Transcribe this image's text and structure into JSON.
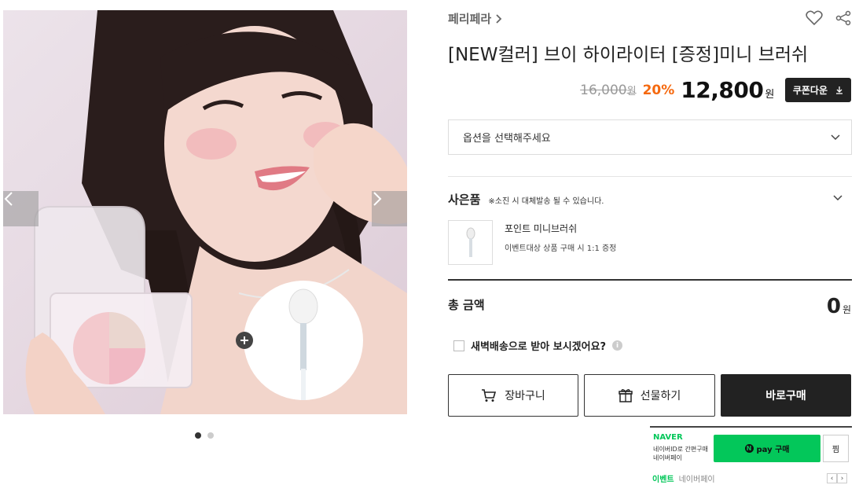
{
  "gallery": {
    "prev_icon": "chevron-left-icon",
    "next_icon": "chevron-right-icon",
    "dot_count": 2,
    "active_dot": 0
  },
  "product": {
    "brand": "페리페라",
    "title": "[NEW컬러] 브이 하이라이터 [증정]미니 브러쉬",
    "original_price": "16,000",
    "original_unit": "원",
    "discount_rate": "20%",
    "final_price": "12,800",
    "final_unit": "원",
    "coupon_label": "쿠폰다운"
  },
  "option": {
    "placeholder": "옵션을 선택해주세요"
  },
  "gift": {
    "heading": "사은품",
    "notice": "※소진 시 대체발송 될 수 있습니다.",
    "name": "포인트 미니브러쉬",
    "desc": "이벤트대상 상품 구매 시 1:1 증정"
  },
  "total": {
    "label": "총 금액",
    "value": "0",
    "unit": "원"
  },
  "dawn_delivery": {
    "label": "새벽배송으로 받아 보시겠어요?",
    "info": "i"
  },
  "buttons": {
    "cart": "장바구니",
    "gift": "선물하기",
    "buy": "바로구매"
  },
  "naver": {
    "logo": "NAVER",
    "line1": "네이버ID로 간편구매",
    "line2": "네이버페이",
    "pay_label": "pay 구매",
    "pay_badge": "N",
    "zzim": "찜",
    "event": "이벤트",
    "event_provider": "네이버페이",
    "prev": "‹",
    "next": "›"
  },
  "colors": {
    "discount": "#f5690f",
    "naver_green": "#03c75a",
    "dark_button": "#222222"
  }
}
